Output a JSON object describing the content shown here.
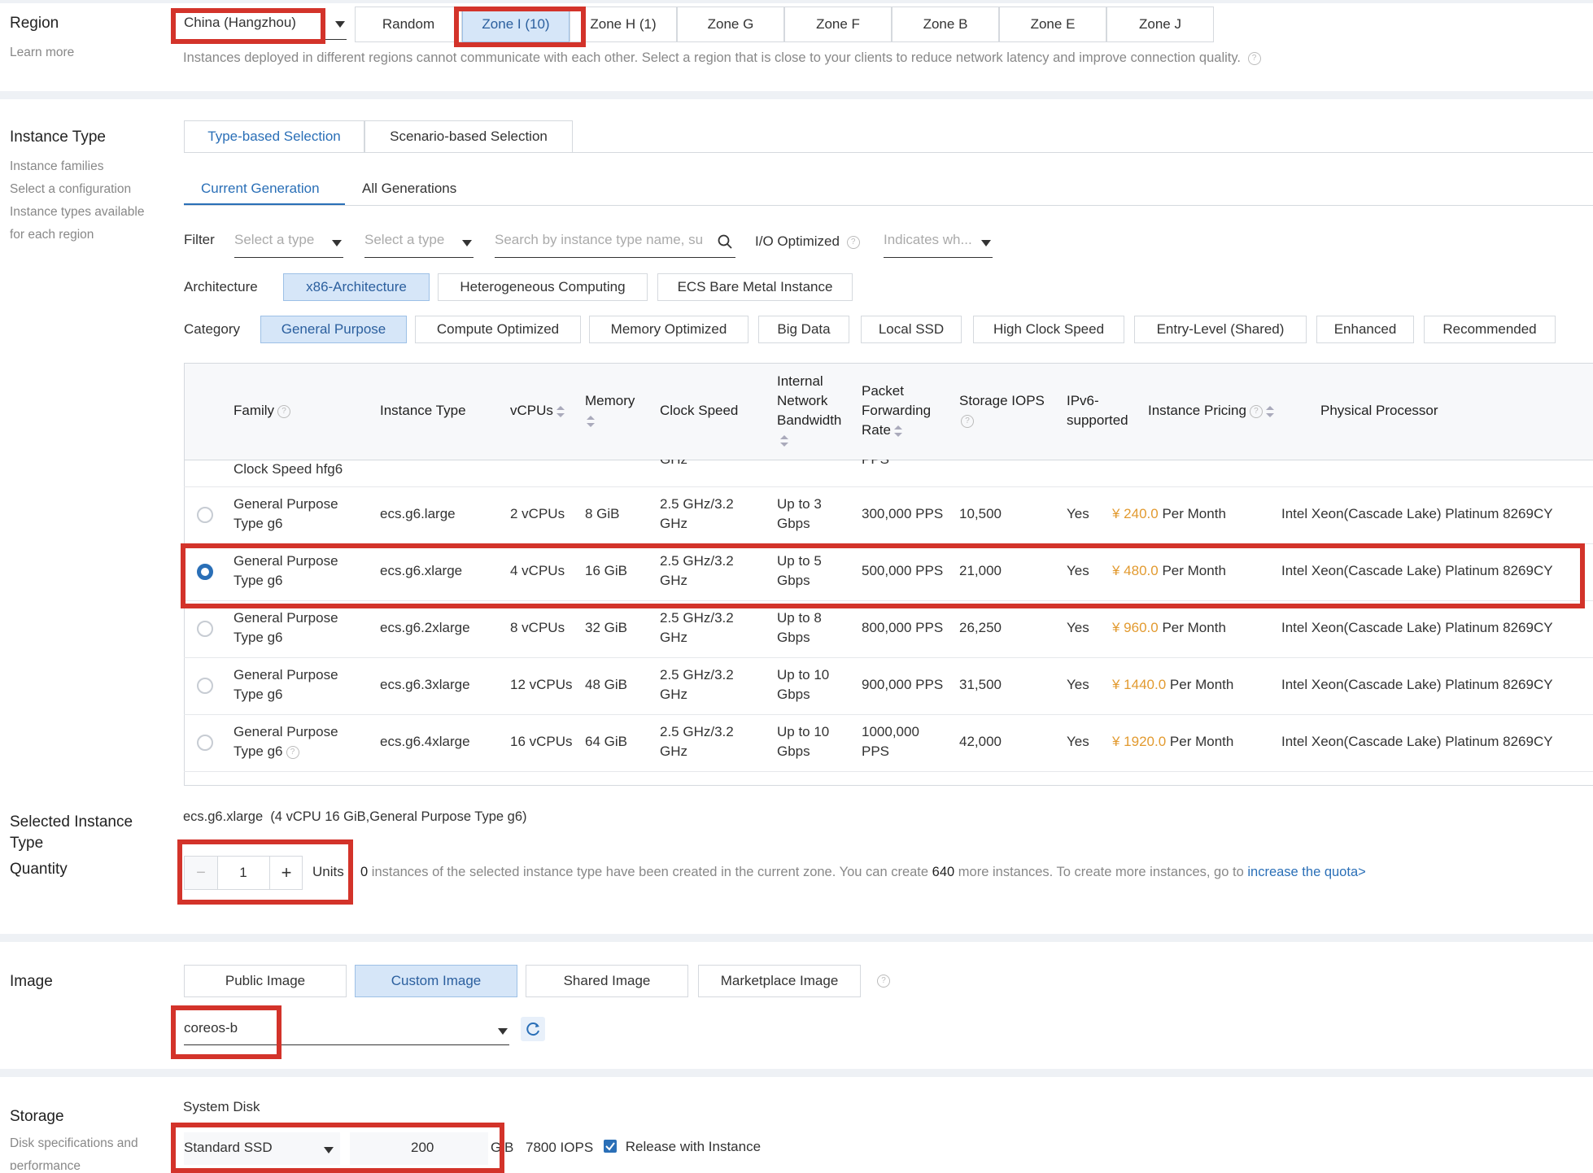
{
  "region": {
    "title": "Region",
    "learn_more": "Learn more",
    "selected_region": "China (Hangzhou)",
    "zones": [
      "Random",
      "Zone I (10)",
      "Zone H (1)",
      "Zone G",
      "Zone F",
      "Zone B",
      "Zone E",
      "Zone J"
    ],
    "selected_zone": "Zone I (10)",
    "note": "Instances deployed in different regions cannot communicate with each other. Select a region that is close to your clients to reduce network latency and improve connection quality."
  },
  "instance_type": {
    "title": "Instance Type",
    "sub": [
      "Instance families",
      "Select a configuration",
      "Instance types available",
      "for each region"
    ],
    "selection_tabs": [
      "Type-based Selection",
      "Scenario-based Selection"
    ],
    "generation_tabs": [
      "Current Generation",
      "All Generations"
    ],
    "filter_label": "Filter",
    "filter_type1": "Select a type",
    "filter_type2": "Select a type",
    "search_placeholder": "Search by instance type name, su",
    "io_label": "I/O Optimized",
    "io_select": "Indicates wh...",
    "architecture_label": "Architecture",
    "architectures": [
      "x86-Architecture",
      "Heterogeneous Computing",
      "ECS Bare Metal Instance"
    ],
    "category_label": "Category",
    "categories": [
      "General Purpose",
      "Compute Optimized",
      "Memory Optimized",
      "Big Data",
      "Local SSD",
      "High Clock Speed",
      "Entry-Level (Shared)",
      "Enhanced",
      "Recommended"
    ]
  },
  "table": {
    "headers": {
      "family": "Family",
      "instance_type": "Instance Type",
      "vcpus": "vCPUs",
      "memory": "Memory",
      "clock": "Clock Speed",
      "bandwidth": [
        "Internal",
        "Network",
        "Bandwidth"
      ],
      "pps": [
        "Packet",
        "Forwarding",
        "Rate"
      ],
      "iops": "Storage IOPS",
      "ipv6": [
        "IPv6-",
        "supported"
      ],
      "pricing": "Instance Pricing",
      "processor": "Physical Processor"
    },
    "partial_row": "Clock Speed hfg6",
    "partial_clock": "GHz",
    "partial_pps": "PPS",
    "rows": [
      {
        "family1": "General Purpose",
        "family2": "Type g6",
        "type": "ecs.g6.large",
        "vcpus": "2 vCPUs",
        "memory": "8 GiB",
        "clock1": "2.5 GHz/3.2",
        "clock2": "GHz",
        "bw1": "Up to 3",
        "bw2": "Gbps",
        "pps": "300,000 PPS",
        "iops": "10,500",
        "ipv6": "Yes",
        "price": "¥ 240.0",
        "per": "Per Month",
        "cpu": "Intel Xeon(Cascade Lake) Platinum 8269CY"
      },
      {
        "family1": "General Purpose",
        "family2": "Type g6",
        "type": "ecs.g6.xlarge",
        "vcpus": "4 vCPUs",
        "memory": "16 GiB",
        "clock1": "2.5 GHz/3.2",
        "clock2": "GHz",
        "bw1": "Up to 5",
        "bw2": "Gbps",
        "pps": "500,000 PPS",
        "iops": "21,000",
        "ipv6": "Yes",
        "price": "¥ 480.0",
        "per": "Per Month",
        "cpu": "Intel Xeon(Cascade Lake) Platinum 8269CY"
      },
      {
        "family1": "General Purpose",
        "family2": "Type g6",
        "type": "ecs.g6.2xlarge",
        "vcpus": "8 vCPUs",
        "memory": "32 GiB",
        "clock1": "2.5 GHz/3.2",
        "clock2": "GHz",
        "bw1": "Up to 8",
        "bw2": "Gbps",
        "pps": "800,000 PPS",
        "iops": "26,250",
        "ipv6": "Yes",
        "price": "¥ 960.0",
        "per": "Per Month",
        "cpu": "Intel Xeon(Cascade Lake) Platinum 8269CY"
      },
      {
        "family1": "General Purpose",
        "family2": "Type g6",
        "type": "ecs.g6.3xlarge",
        "vcpus": "12 vCPUs",
        "memory": "48 GiB",
        "clock1": "2.5 GHz/3.2",
        "clock2": "GHz",
        "bw1": "Up to 10",
        "bw2": "Gbps",
        "pps": "900,000 PPS",
        "iops": "31,500",
        "ipv6": "Yes",
        "price": "¥ 1440.0",
        "per": "Per Month",
        "cpu": "Intel Xeon(Cascade Lake) Platinum 8269CY"
      },
      {
        "family1": "General Purpose",
        "family2": "Type g6",
        "type": "ecs.g6.4xlarge",
        "vcpus": "16 vCPUs",
        "memory": "64 GiB",
        "clock1": "2.5 GHz/3.2",
        "clock2": "GHz",
        "bw1": "Up to 10",
        "bw2": "Gbps",
        "pps": "1000,000",
        "pps2": "PPS",
        "iops": "42,000",
        "ipv6": "Yes",
        "price": "¥ 1920.0",
        "per": "Per Month",
        "cpu": "Intel Xeon(Cascade Lake) Platinum 8269CY"
      }
    ],
    "selected_row": 1
  },
  "selected": {
    "title1": "Selected Instance",
    "title2": "Type",
    "value": "ecs.g6.xlarge",
    "detail": "(4 vCPU 16 GiB,General Purpose Type g6)"
  },
  "quantity": {
    "title": "Quantity",
    "minus": "−",
    "value": "1",
    "plus": "+",
    "units": "Units",
    "created_count": "0",
    "msg1": "instances of the selected instance type have been created in the current zone. You can create",
    "can_create": "640",
    "msg2": "more instances. To create more instances, go to",
    "link": "increase the quota>"
  },
  "image": {
    "title": "Image",
    "tabs": [
      "Public Image",
      "Custom Image",
      "Shared Image",
      "Marketplace Image"
    ],
    "selected_tab": "Custom Image",
    "value": "coreos-b"
  },
  "storage": {
    "title": "Storage",
    "sub1": "Disk specifications and",
    "sub2": "performance",
    "system_disk": "System Disk",
    "disk_type": "Standard SSD",
    "size": "200",
    "unit": "GiB",
    "iops": "7800 IOPS",
    "release": "Release with Instance",
    "release_checked": true
  },
  "colors": {
    "accent": "#2a6fb7",
    "highlight": "#d3332a",
    "price": "#e29a2f",
    "selected_bg": "#d6e6f8"
  }
}
